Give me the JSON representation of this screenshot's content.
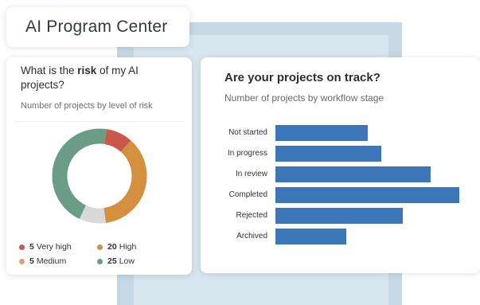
{
  "app": {
    "title": "AI Program Center"
  },
  "risk_card": {
    "question_pre": "What is the ",
    "question_bold": "risk",
    "question_post": " of my AI projects?",
    "subtitle": "Number of projects by level of risk",
    "legend": [
      {
        "count": "5",
        "label": "Very high",
        "color": "#c9584a"
      },
      {
        "count": "20",
        "label": "High",
        "color": "#d4903f"
      },
      {
        "count": "5",
        "label": "Medium",
        "color": "#e0a074"
      },
      {
        "count": "25",
        "label": "Low",
        "color": "#6b9c85"
      }
    ]
  },
  "track_card": {
    "question": "Are your projects on track?",
    "subtitle": "Number of projects by workflow stage"
  },
  "chart_data": [
    {
      "type": "pie",
      "title": "What is the risk of my AI projects?",
      "subtitle": "Number of projects by level of risk",
      "categories": [
        "Very high",
        "High",
        "Medium",
        "Low"
      ],
      "values": [
        5,
        20,
        5,
        25
      ],
      "colors": [
        "#c9584a",
        "#d4903f",
        "#d9d9d9",
        "#6b9c85"
      ],
      "donut": true,
      "legend": "bottom"
    },
    {
      "type": "bar",
      "orientation": "horizontal",
      "title": "Are your projects on track?",
      "subtitle": "Number of projects by workflow stage",
      "categories": [
        "Not started",
        "In progress",
        "In review",
        "Completed",
        "Rejected",
        "Archived"
      ],
      "values": [
        13,
        15,
        22,
        26,
        18,
        10
      ],
      "xlim": [
        0,
        26
      ],
      "color": "#3a76b8",
      "grid": false
    }
  ]
}
